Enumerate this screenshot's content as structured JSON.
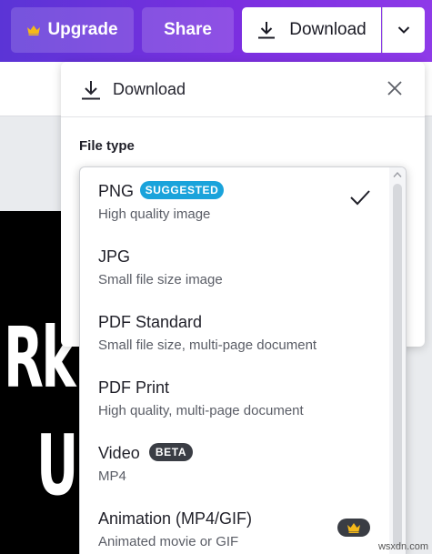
{
  "toolbar": {
    "upgrade_label": "Upgrade",
    "share_label": "Share",
    "download_label": "Download"
  },
  "background": {
    "partial_text_line1": "Rk",
    "partial_text_line2": "U"
  },
  "panel": {
    "title": "Download",
    "file_type_label": "File type"
  },
  "file_types": [
    {
      "name": "PNG",
      "description": "High quality image",
      "badge": "SUGGESTED",
      "selected": true
    },
    {
      "name": "JPG",
      "description": "Small file size image"
    },
    {
      "name": "PDF Standard",
      "description": "Small file size, multi-page document"
    },
    {
      "name": "PDF Print",
      "description": "High quality, multi-page document"
    },
    {
      "name": "Video",
      "description": "MP4",
      "badge": "BETA"
    },
    {
      "name": "Animation (MP4/GIF)",
      "description": "Animated movie or GIF",
      "pro": true
    }
  ],
  "watermark": "wsxdn.com",
  "colors": {
    "accent_purple": "#7b2fe0",
    "suggested_badge": "#1aa3db",
    "beta_badge": "#3a3d44",
    "crown": "#f5b91a"
  }
}
